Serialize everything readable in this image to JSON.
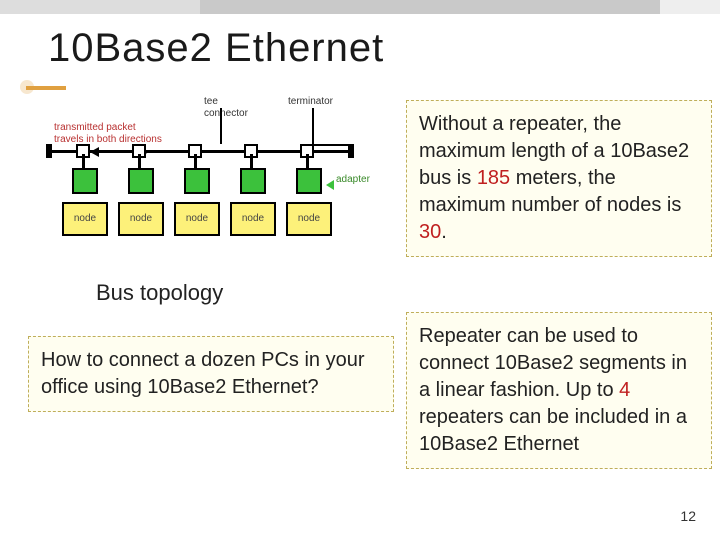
{
  "title": "10Base2 Ethernet",
  "diagram": {
    "packet_label_l1": "transmitted packet",
    "packet_label_l2": "travels in both directions",
    "tee_label_l1": "tee",
    "tee_label_l2": "connector",
    "terminator_label": "terminator",
    "adapter_label": "adapter",
    "node_label": "node",
    "node_count": 5
  },
  "caption": "Bus topology",
  "question": "How to connect a dozen PCs in your office using 10Base2 Ethernet?",
  "right1": {
    "pre": "Without a repeater, the maximum length of a 10Base2 bus is ",
    "v185": "185",
    "mid": " meters, the maximum number of nodes is ",
    "v30": "30",
    "post": "."
  },
  "right2": {
    "pre": "Repeater can be used to connect 10Base2 segments in a linear fashion. Up to ",
    "v4": "4",
    "post": " repeaters can be included in a 10Base2 Ethernet"
  },
  "page_number": "12"
}
